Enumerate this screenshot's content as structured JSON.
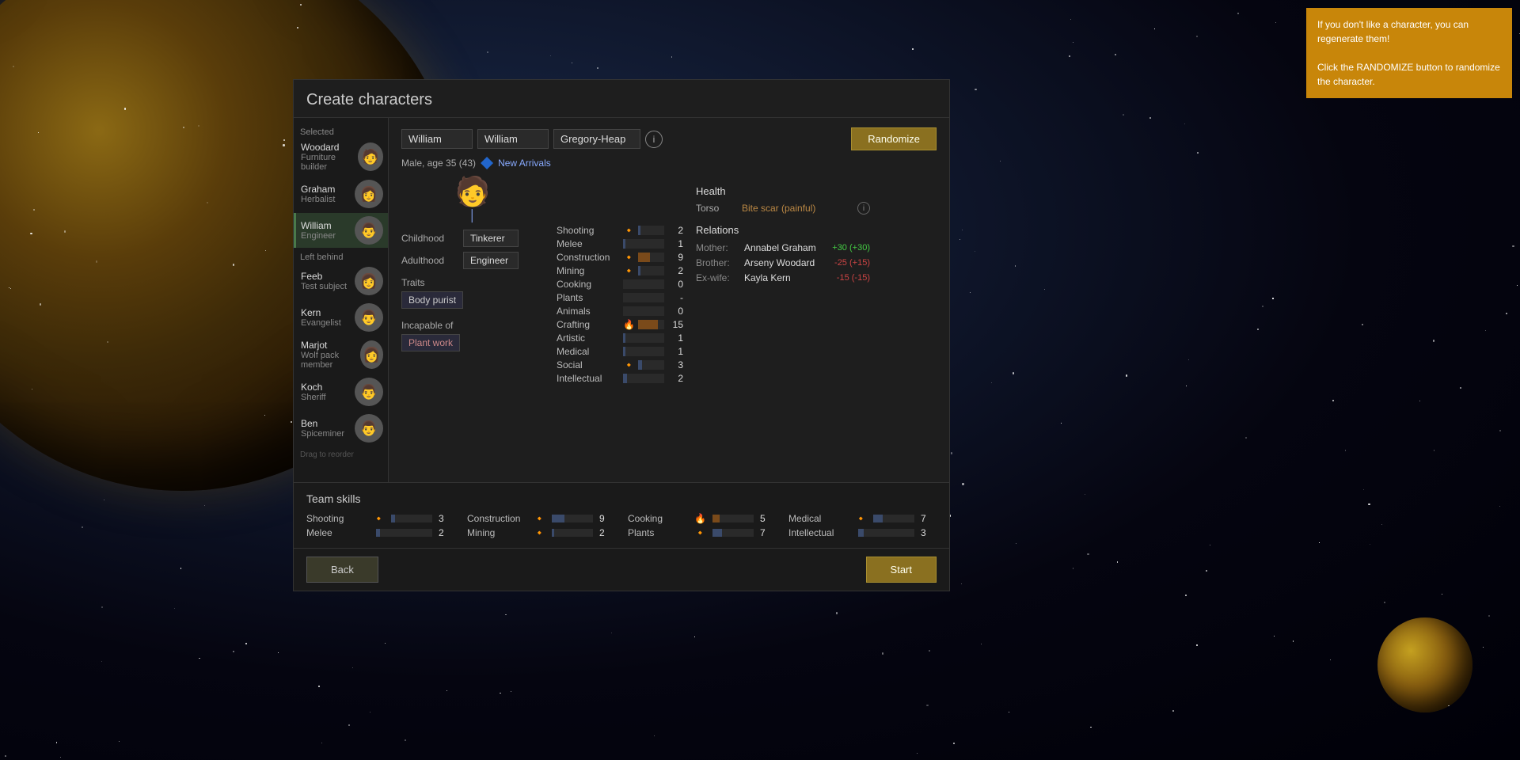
{
  "tooltip": {
    "line1": "If you don't like a character, you can regenerate them!",
    "line2": "Click the RANDOMIZE button to randomize the character."
  },
  "dialog": {
    "title": "Create characters"
  },
  "sidebar": {
    "selected_label": "Selected",
    "left_behind_label": "Left behind",
    "drag_hint": "Drag to reorder",
    "selected_chars": [
      {
        "name": "Woodard",
        "role": "Furniture builder",
        "avatar": "👤"
      },
      {
        "name": "Graham",
        "role": "Herbalist",
        "avatar": "👤"
      },
      {
        "name": "William",
        "role": "Engineer",
        "avatar": "👤",
        "active": true
      }
    ],
    "left_behind_chars": [
      {
        "name": "Feeb",
        "role": "Test subject",
        "avatar": "👤"
      },
      {
        "name": "Kern",
        "role": "Evangelist",
        "avatar": "👤"
      },
      {
        "name": "Marjot",
        "role": "Wolf pack member",
        "avatar": "👤"
      },
      {
        "name": "Koch",
        "role": "Sheriff",
        "avatar": "👤"
      },
      {
        "name": "Ben",
        "role": "Spiceminer",
        "avatar": "👤"
      }
    ]
  },
  "character": {
    "first_name": "William",
    "nick_name": "William",
    "last_name": "Gregory-Heap",
    "bio": "Male, age 35 (43)",
    "faction": "New Arrivals",
    "childhood": "Tinkerer",
    "adulthood": "Engineer",
    "traits": [
      "Body purist"
    ],
    "incapable_of": [
      "Plant work"
    ],
    "randomize_label": "Randomize"
  },
  "skills": [
    {
      "name": "Shooting",
      "value": 2,
      "max": 20,
      "hot": false,
      "flames": 1
    },
    {
      "name": "Melee",
      "value": 1,
      "max": 20,
      "hot": false,
      "flames": 0
    },
    {
      "name": "Construction",
      "value": 9,
      "max": 20,
      "hot": true,
      "flames": 1
    },
    {
      "name": "Mining",
      "value": 2,
      "max": 20,
      "hot": false,
      "flames": 1
    },
    {
      "name": "Cooking",
      "value": 0,
      "max": 20,
      "hot": false,
      "flames": 0
    },
    {
      "name": "Plants",
      "value": "-",
      "max": 20,
      "hot": false,
      "flames": 0
    },
    {
      "name": "Animals",
      "value": 0,
      "max": 20,
      "hot": false,
      "flames": 0
    },
    {
      "name": "Crafting",
      "value": 15,
      "max": 20,
      "hot": true,
      "flames": 2
    },
    {
      "name": "Artistic",
      "value": 1,
      "max": 20,
      "hot": false,
      "flames": 0
    },
    {
      "name": "Medical",
      "value": 1,
      "max": 20,
      "hot": false,
      "flames": 0
    },
    {
      "name": "Social",
      "value": 3,
      "max": 20,
      "hot": false,
      "flames": 1
    },
    {
      "name": "Intellectual",
      "value": 2,
      "max": 20,
      "hot": false,
      "flames": 0
    }
  ],
  "health": {
    "title": "Health",
    "conditions": [
      {
        "part": "Torso",
        "status": "Bite scar (painful)"
      }
    ]
  },
  "relations": {
    "title": "Relations",
    "items": [
      {
        "type": "Mother:",
        "name": "Annabel Graham",
        "score": "+30",
        "detail": "(+30)",
        "positive": true
      },
      {
        "type": "Brother:",
        "name": "Arseny Woodard",
        "score": "-25",
        "detail": "(+15)",
        "positive": false
      },
      {
        "type": "Ex-wife:",
        "name": "Kayla Kern",
        "score": "-15",
        "detail": "(-15)",
        "positive": false
      }
    ]
  },
  "team_skills": {
    "title": "Team skills",
    "skills": [
      {
        "name": "Shooting",
        "value": 3,
        "max": 30,
        "hot": false,
        "flames": 1,
        "col": 0
      },
      {
        "name": "Melee",
        "value": 2,
        "max": 30,
        "hot": false,
        "flames": 0,
        "col": 0
      },
      {
        "name": "Construction",
        "value": 9,
        "max": 30,
        "hot": false,
        "flames": 1,
        "col": 1
      },
      {
        "name": "Mining",
        "value": 2,
        "max": 30,
        "hot": false,
        "flames": 1,
        "col": 1
      },
      {
        "name": "Cooking",
        "value": 5,
        "max": 30,
        "hot": true,
        "flames": 2,
        "col": 2
      },
      {
        "name": "Plants",
        "value": 7,
        "max": 30,
        "hot": false,
        "flames": 1,
        "col": 2
      },
      {
        "name": "Medical",
        "value": 7,
        "max": 30,
        "hot": false,
        "flames": 1,
        "col": 3
      },
      {
        "name": "Intellectual",
        "value": 3,
        "max": 30,
        "hot": false,
        "flames": 0,
        "col": 3
      }
    ]
  },
  "footer": {
    "back_label": "Back",
    "start_label": "Start"
  }
}
